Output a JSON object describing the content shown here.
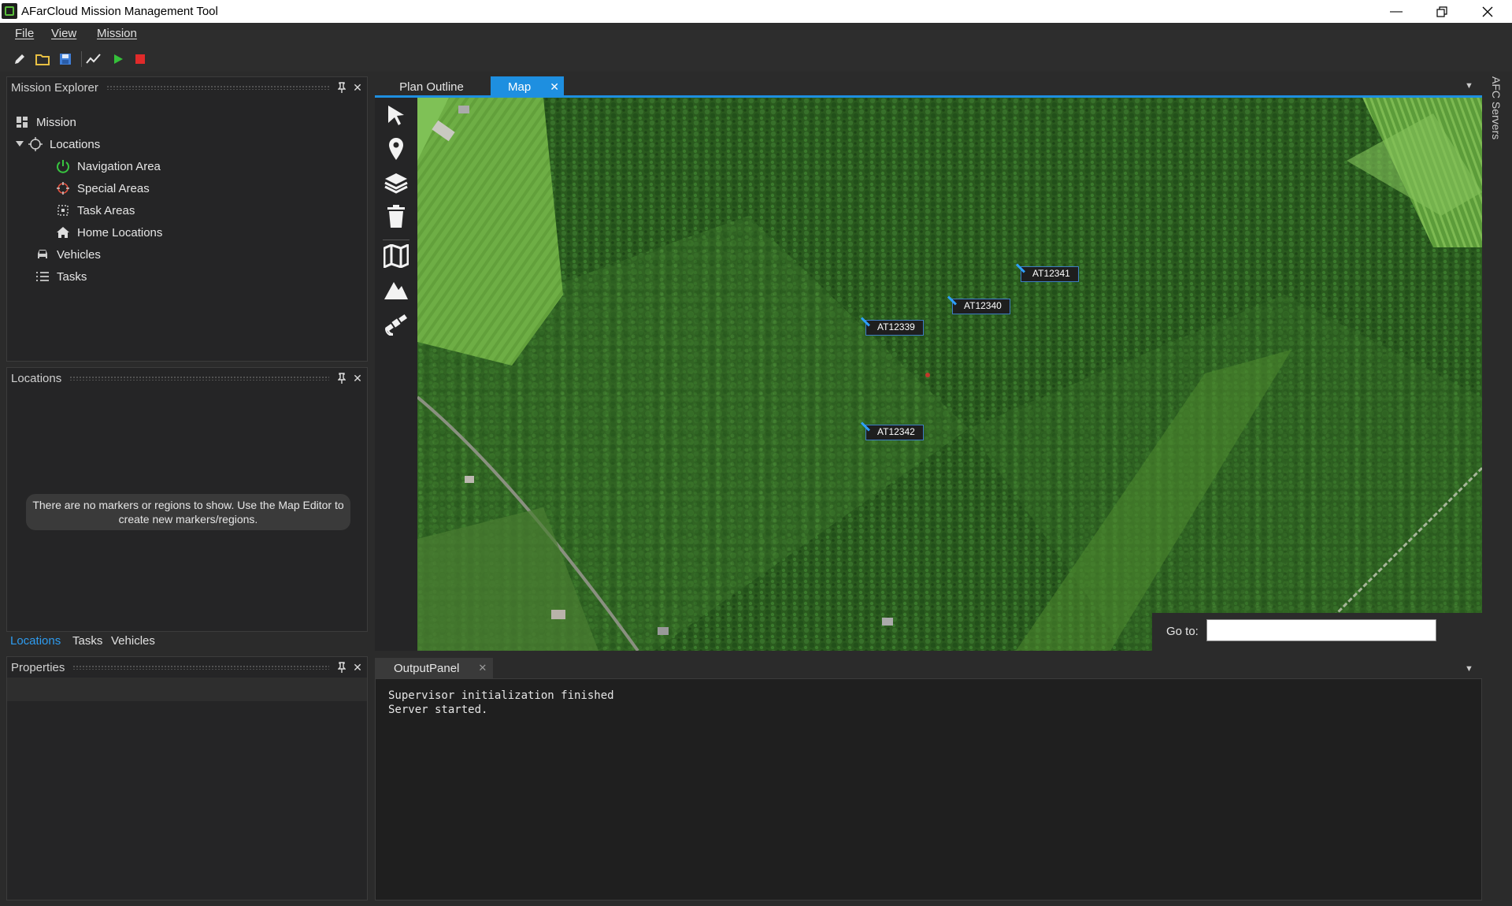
{
  "window": {
    "title": "AFarCloud Mission Management Tool",
    "minimize_icon": "minimize-icon",
    "restore_icon": "restore-icon",
    "close_icon": "close-icon"
  },
  "menu": {
    "file": "File",
    "view": "View",
    "mission": "Mission"
  },
  "toolbar": {
    "icons": [
      "pencil-icon",
      "open-folder-icon",
      "save-icon",
      "chart-line-icon",
      "play-icon",
      "stop-icon"
    ]
  },
  "mission_explorer": {
    "title": "Mission Explorer",
    "tree": {
      "mission": "Mission",
      "locations": "Locations",
      "navigation_area": "Navigation Area",
      "special_areas": "Special Areas",
      "task_areas": "Task Areas",
      "home_locations": "Home Locations",
      "vehicles": "Vehicles",
      "tasks": "Tasks"
    }
  },
  "locations_panel": {
    "title": "Locations",
    "empty_message": "There are no markers or regions to show. Use the Map Editor to create new markers/regions.",
    "tabs": [
      "Locations",
      "Tasks",
      "Vehicles"
    ],
    "active_tab": "Locations"
  },
  "properties_panel": {
    "title": "Properties"
  },
  "document_tabs": {
    "plan_outline": "Plan Outline",
    "map": "Map"
  },
  "map": {
    "tools": [
      "pointer-icon",
      "map-pin-icon",
      "layers-icon",
      "trash-icon",
      "map-icon",
      "mountain-icon",
      "satellite-icon"
    ],
    "markers": [
      {
        "label": "AT12341"
      },
      {
        "label": "AT12340"
      },
      {
        "label": "AT12339"
      },
      {
        "label": "AT12342"
      }
    ],
    "goto_label": "Go to:",
    "goto_value": ""
  },
  "output_panel": {
    "tab": "OutputPanel",
    "lines": [
      "Supervisor initialization finished",
      "Server started."
    ]
  },
  "side_rail": {
    "label": "AFC Servers"
  },
  "colors": {
    "accent": "#1e8fe0",
    "background": "#2b2b2b",
    "panel": "#252526"
  }
}
